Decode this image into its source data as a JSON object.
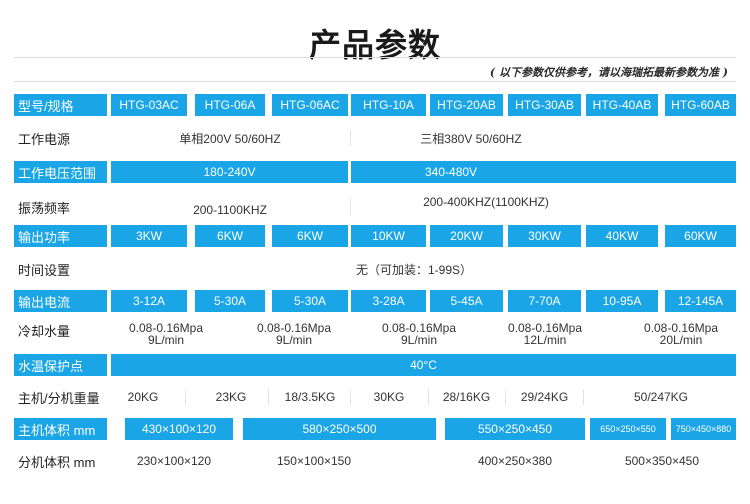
{
  "title": "产品参数",
  "subtitle": "( 以下参数仅供参考，请以海瑞拓最新参数为准 )",
  "rows": {
    "model": {
      "label": "型号/规格",
      "values": [
        "HTG-03AC",
        "HTG-06A",
        "HTG-06AC",
        "HTG-10A",
        "HTG-20AB",
        "HTG-30AB",
        "HTG-40AB",
        "HTG-60AB"
      ]
    },
    "power_supply": {
      "label": "工作电源",
      "values": [
        "单相200V 50/60HZ",
        "三相380V 50/60HZ"
      ]
    },
    "voltage_range": {
      "label": "工作电压范围",
      "values": [
        "180-240V",
        "340-480V"
      ]
    },
    "frequency": {
      "label": "振荡频率",
      "values": [
        "200-1100KHZ",
        "200-400KHZ(1100KHZ)"
      ]
    },
    "output_power": {
      "label": "输出功率",
      "values": [
        "3KW",
        "6KW",
        "6KW",
        "10KW",
        "20KW",
        "30KW",
        "40KW",
        "60KW"
      ]
    },
    "time_setting": {
      "label": "时间设置",
      "value": "无（可加装：1-99S）"
    },
    "output_current": {
      "label": "输出电流",
      "values": [
        "3-12A",
        "5-30A",
        "5-30A",
        "3-28A",
        "5-45A",
        "7-70A",
        "10-95A",
        "12-145A"
      ]
    },
    "cooling_water": {
      "label": "冷却水量",
      "values": [
        {
          "l1": "0.08-0.16Mpa",
          "l2": "9L/min"
        },
        {
          "l1": "0.08-0.16Mpa",
          "l2": "9L/min"
        },
        {
          "l1": "0.08-0.16Mpa",
          "l2": "9L/min"
        },
        {
          "l1": "0.08-0.16Mpa",
          "l2": "12L/min"
        },
        {
          "l1": "0.08-0.16Mpa",
          "l2": "20L/min"
        }
      ]
    },
    "water_temp": {
      "label": "水温保护点",
      "value": "40°C"
    },
    "weight": {
      "label": "主机/分机重量",
      "values": [
        "20KG",
        "23KG",
        "18/3.5KG",
        "30KG",
        "28/16KG",
        "29/24KG",
        "50/247KG"
      ]
    },
    "main_volume": {
      "label": "主机体积 mm",
      "values": [
        "430×100×120",
        "580×250×500",
        "550×250×450",
        "650×250×550",
        "750×450×880"
      ]
    },
    "sub_volume": {
      "label": "分机体积 mm",
      "values": [
        "230×100×120",
        "150×100×150",
        "400×250×380",
        "500×350×450"
      ]
    }
  }
}
